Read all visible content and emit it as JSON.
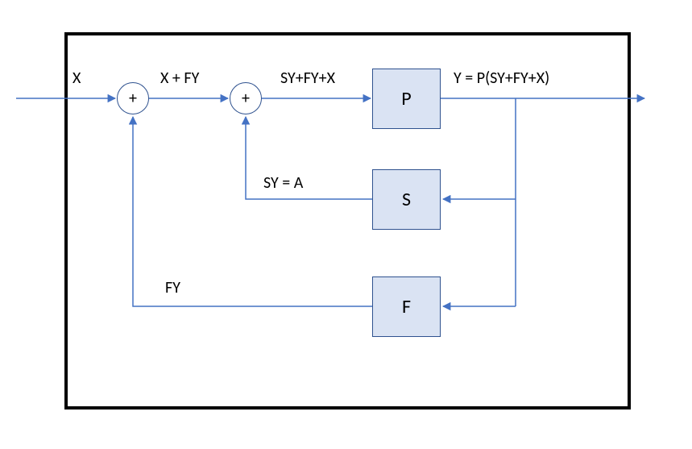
{
  "diagram": {
    "input_label": "X",
    "sum1_symbol": "+",
    "sum2_symbol": "+",
    "signal_after_sum1": "X + FY",
    "signal_after_sum2": "SY+FY+X",
    "output_label": "Y = P(SY+FY+X)",
    "feedback_s_label": "SY = A",
    "feedback_f_label": "FY",
    "blocks": {
      "P": "P",
      "S": "S",
      "F": "F"
    },
    "colors": {
      "block_fill": "#dae3f3",
      "block_stroke": "#2f528f",
      "arrow": "#4472c4",
      "outer_border": "#000000"
    }
  }
}
